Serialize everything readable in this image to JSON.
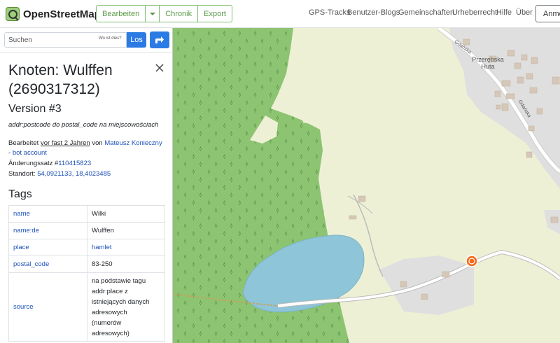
{
  "header": {
    "logo_text": "OpenStreetMap",
    "edit_label": "Bearbeiten",
    "history_label": "Chronik",
    "export_label": "Export",
    "nav": [
      "GPS-Tracks",
      "Benutzer-Blogs",
      "Gemeinschaften",
      "Urheberrecht",
      "Hilfe",
      "Über"
    ],
    "login_label": "Anme"
  },
  "search": {
    "placeholder": "Suchen",
    "where_link": "Wo ist dies?",
    "go_label": "Los"
  },
  "node": {
    "title_line1": "Knoten: Wulffen",
    "title_line2": "(2690317312)",
    "version": "Version #3",
    "comment": "addr:postcode do postal_code na miejscowościach",
    "edited_prefix": "Bearbeitet",
    "edited_time": "vor fast 2 Jahren",
    "edited_by": "von",
    "user": "Mateusz Konieczny",
    "bot_dash": "-",
    "bot_account": "bot account",
    "changeset_label": "Änderungssatz #",
    "changeset_id": "110415823",
    "location_label": "Standort:",
    "location": "54,0921133, 18,4023485"
  },
  "tags": {
    "heading": "Tags",
    "rows": [
      {
        "key": "name",
        "value": "Wilki"
      },
      {
        "key": "name:de",
        "value": "Wulffen"
      },
      {
        "key": "place",
        "value": "hamlet"
      },
      {
        "key": "postal_code",
        "value": "83-250"
      },
      {
        "key": "source",
        "value_lines": [
          "na podstawie tagu",
          "addr:place z",
          "istniejących danych",
          "adresowych",
          "(numerów",
          "adresowych)"
        ]
      }
    ]
  },
  "map": {
    "village_line1": "Przerębska",
    "village_line2": "Huta",
    "road_label_1": "Gdańska",
    "road_label_2": "Gdańska",
    "colors": {
      "forest": "#8cc472",
      "farmland": "#eef0d5",
      "water": "#8ec5d8",
      "residential": "#e0dfdf",
      "building": "#d5c8b8",
      "marker": "#f56a1a"
    }
  }
}
